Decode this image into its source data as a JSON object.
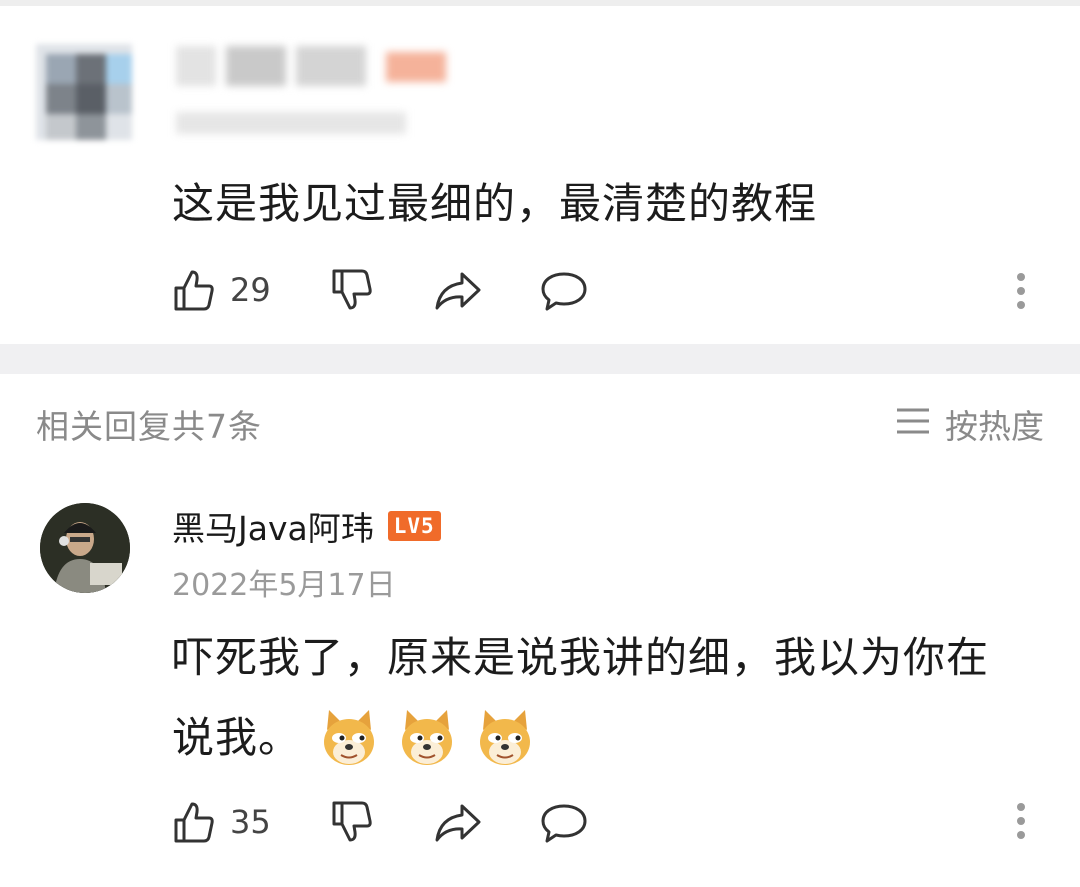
{
  "comment": {
    "text": "这是我见过最细的，最清楚的教程",
    "likes": "29"
  },
  "replies_section": {
    "title": "相关回复共7条",
    "sort_label": "按热度"
  },
  "reply": {
    "author": "黑马Java阿玮",
    "level_badge": "LV5",
    "date": "2022年5月17日",
    "text_line1": "吓死我了，原来是说我讲的细，我以为你在",
    "text_line2": "说我。",
    "emojis": [
      "doge-emoji",
      "doge-emoji",
      "doge-emoji"
    ],
    "likes": "35"
  },
  "colors": {
    "badge": "#f06b2a",
    "muted_text": "#8a8a8a",
    "separator": "#f0f0f2"
  },
  "icons": [
    "thumbs-up-icon",
    "thumbs-down-icon",
    "share-icon",
    "comment-icon",
    "more-vertical-icon",
    "sort-lines-icon"
  ]
}
